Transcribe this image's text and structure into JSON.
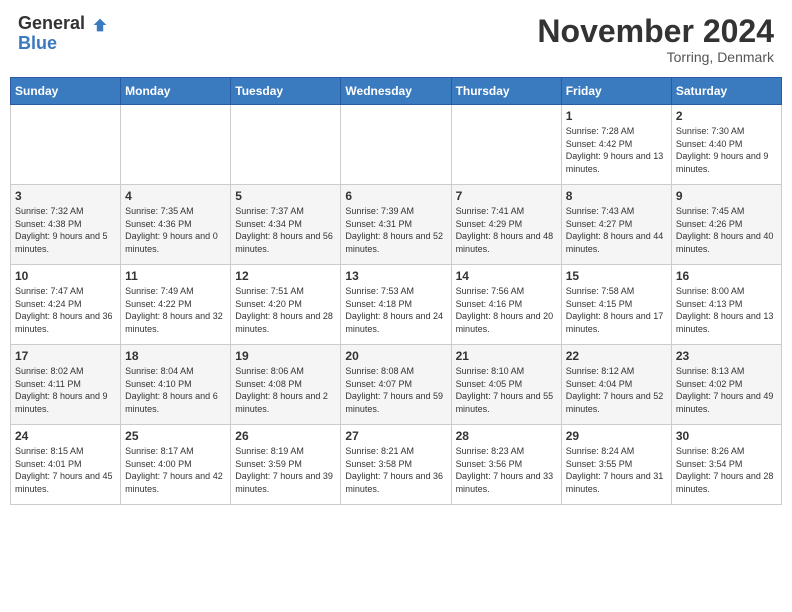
{
  "header": {
    "logo": {
      "general": "General",
      "blue": "Blue"
    },
    "title": "November 2024",
    "location": "Torring, Denmark"
  },
  "calendar": {
    "weekdays": [
      "Sunday",
      "Monday",
      "Tuesday",
      "Wednesday",
      "Thursday",
      "Friday",
      "Saturday"
    ],
    "weeks": [
      [
        {
          "day": "",
          "info": ""
        },
        {
          "day": "",
          "info": ""
        },
        {
          "day": "",
          "info": ""
        },
        {
          "day": "",
          "info": ""
        },
        {
          "day": "",
          "info": ""
        },
        {
          "day": "1",
          "info": "Sunrise: 7:28 AM\nSunset: 4:42 PM\nDaylight: 9 hours and 13 minutes."
        },
        {
          "day": "2",
          "info": "Sunrise: 7:30 AM\nSunset: 4:40 PM\nDaylight: 9 hours and 9 minutes."
        }
      ],
      [
        {
          "day": "3",
          "info": "Sunrise: 7:32 AM\nSunset: 4:38 PM\nDaylight: 9 hours and 5 minutes."
        },
        {
          "day": "4",
          "info": "Sunrise: 7:35 AM\nSunset: 4:36 PM\nDaylight: 9 hours and 0 minutes."
        },
        {
          "day": "5",
          "info": "Sunrise: 7:37 AM\nSunset: 4:34 PM\nDaylight: 8 hours and 56 minutes."
        },
        {
          "day": "6",
          "info": "Sunrise: 7:39 AM\nSunset: 4:31 PM\nDaylight: 8 hours and 52 minutes."
        },
        {
          "day": "7",
          "info": "Sunrise: 7:41 AM\nSunset: 4:29 PM\nDaylight: 8 hours and 48 minutes."
        },
        {
          "day": "8",
          "info": "Sunrise: 7:43 AM\nSunset: 4:27 PM\nDaylight: 8 hours and 44 minutes."
        },
        {
          "day": "9",
          "info": "Sunrise: 7:45 AM\nSunset: 4:26 PM\nDaylight: 8 hours and 40 minutes."
        }
      ],
      [
        {
          "day": "10",
          "info": "Sunrise: 7:47 AM\nSunset: 4:24 PM\nDaylight: 8 hours and 36 minutes."
        },
        {
          "day": "11",
          "info": "Sunrise: 7:49 AM\nSunset: 4:22 PM\nDaylight: 8 hours and 32 minutes."
        },
        {
          "day": "12",
          "info": "Sunrise: 7:51 AM\nSunset: 4:20 PM\nDaylight: 8 hours and 28 minutes."
        },
        {
          "day": "13",
          "info": "Sunrise: 7:53 AM\nSunset: 4:18 PM\nDaylight: 8 hours and 24 minutes."
        },
        {
          "day": "14",
          "info": "Sunrise: 7:56 AM\nSunset: 4:16 PM\nDaylight: 8 hours and 20 minutes."
        },
        {
          "day": "15",
          "info": "Sunrise: 7:58 AM\nSunset: 4:15 PM\nDaylight: 8 hours and 17 minutes."
        },
        {
          "day": "16",
          "info": "Sunrise: 8:00 AM\nSunset: 4:13 PM\nDaylight: 8 hours and 13 minutes."
        }
      ],
      [
        {
          "day": "17",
          "info": "Sunrise: 8:02 AM\nSunset: 4:11 PM\nDaylight: 8 hours and 9 minutes."
        },
        {
          "day": "18",
          "info": "Sunrise: 8:04 AM\nSunset: 4:10 PM\nDaylight: 8 hours and 6 minutes."
        },
        {
          "day": "19",
          "info": "Sunrise: 8:06 AM\nSunset: 4:08 PM\nDaylight: 8 hours and 2 minutes."
        },
        {
          "day": "20",
          "info": "Sunrise: 8:08 AM\nSunset: 4:07 PM\nDaylight: 7 hours and 59 minutes."
        },
        {
          "day": "21",
          "info": "Sunrise: 8:10 AM\nSunset: 4:05 PM\nDaylight: 7 hours and 55 minutes."
        },
        {
          "day": "22",
          "info": "Sunrise: 8:12 AM\nSunset: 4:04 PM\nDaylight: 7 hours and 52 minutes."
        },
        {
          "day": "23",
          "info": "Sunrise: 8:13 AM\nSunset: 4:02 PM\nDaylight: 7 hours and 49 minutes."
        }
      ],
      [
        {
          "day": "24",
          "info": "Sunrise: 8:15 AM\nSunset: 4:01 PM\nDaylight: 7 hours and 45 minutes."
        },
        {
          "day": "25",
          "info": "Sunrise: 8:17 AM\nSunset: 4:00 PM\nDaylight: 7 hours and 42 minutes."
        },
        {
          "day": "26",
          "info": "Sunrise: 8:19 AM\nSunset: 3:59 PM\nDaylight: 7 hours and 39 minutes."
        },
        {
          "day": "27",
          "info": "Sunrise: 8:21 AM\nSunset: 3:58 PM\nDaylight: 7 hours and 36 minutes."
        },
        {
          "day": "28",
          "info": "Sunrise: 8:23 AM\nSunset: 3:56 PM\nDaylight: 7 hours and 33 minutes."
        },
        {
          "day": "29",
          "info": "Sunrise: 8:24 AM\nSunset: 3:55 PM\nDaylight: 7 hours and 31 minutes."
        },
        {
          "day": "30",
          "info": "Sunrise: 8:26 AM\nSunset: 3:54 PM\nDaylight: 7 hours and 28 minutes."
        }
      ]
    ]
  }
}
